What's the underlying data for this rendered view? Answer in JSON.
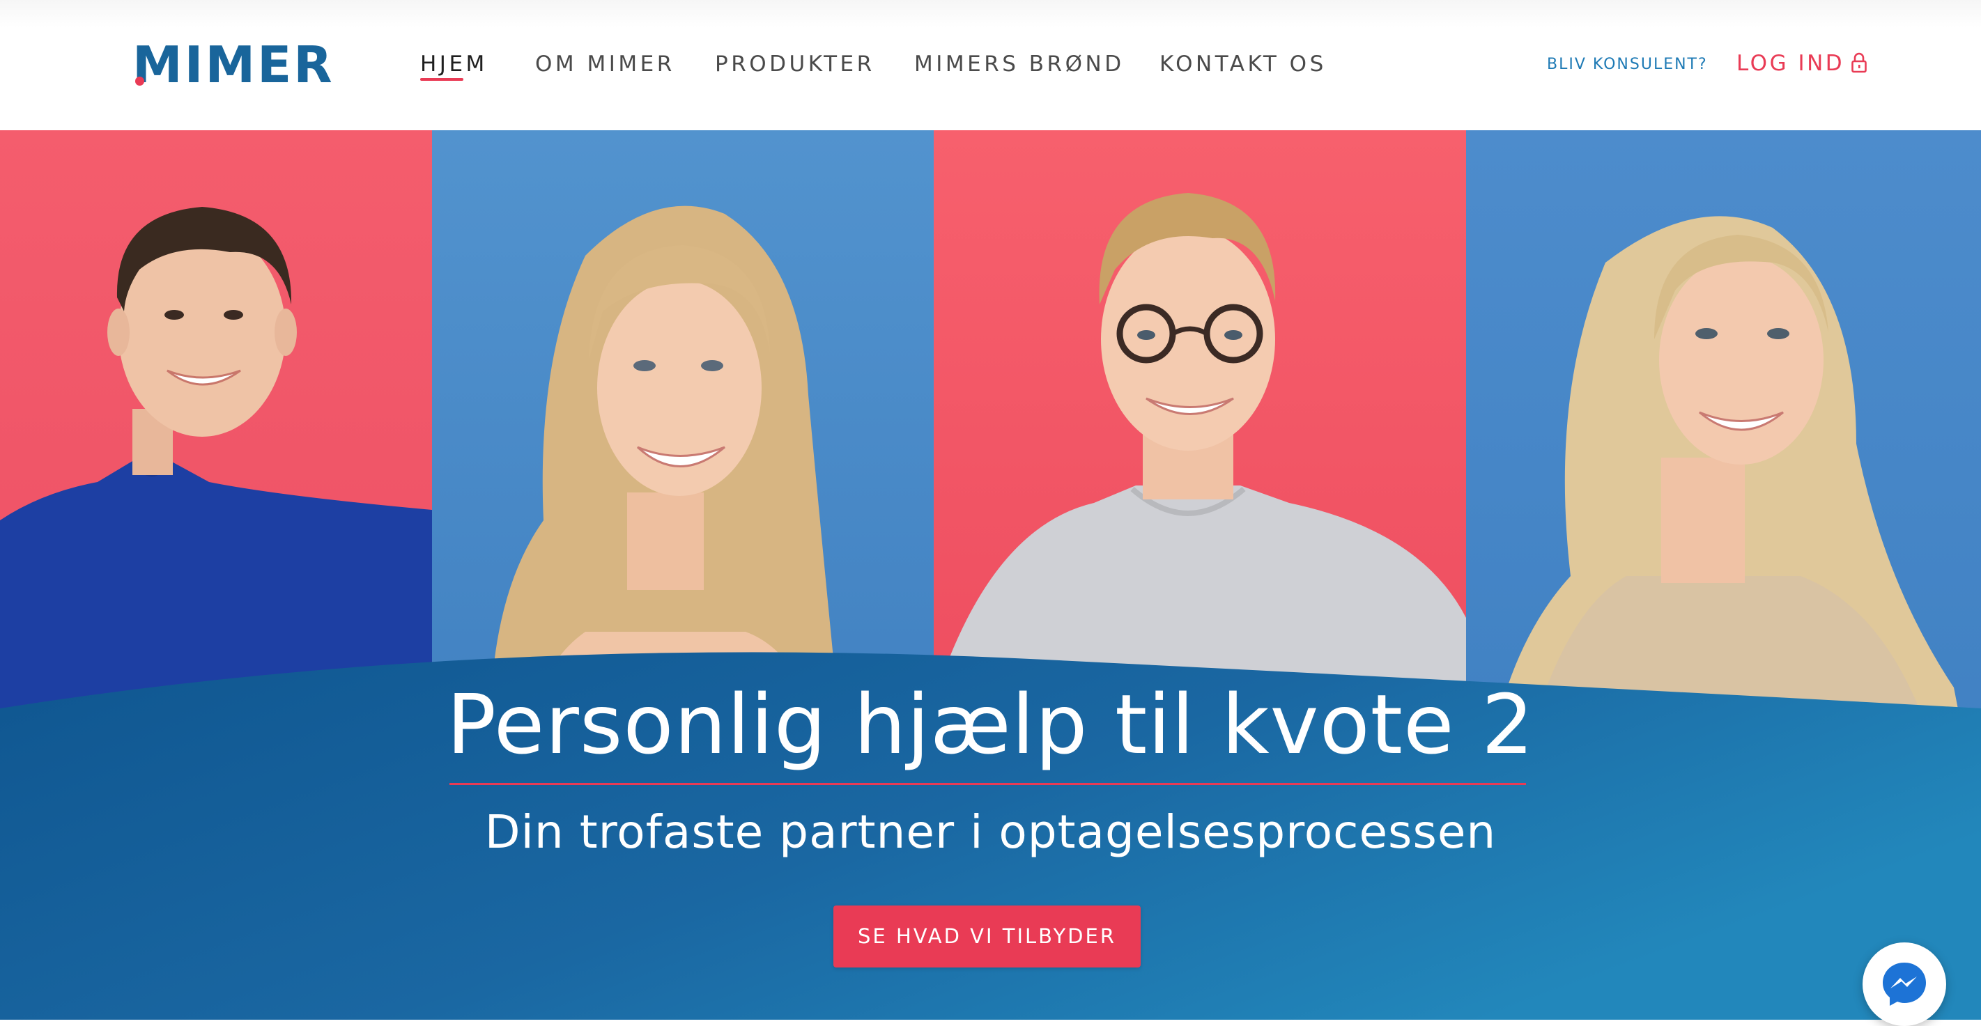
{
  "brand": {
    "name": "MIMER",
    "primary": "#19659b",
    "accent": "#e93b55"
  },
  "nav": {
    "items": [
      {
        "label": "HJEM",
        "active": true
      },
      {
        "label": "OM MIMER",
        "active": false
      },
      {
        "label": "PRODUKTER",
        "active": false
      },
      {
        "label": "MIMERS BRØND",
        "active": false
      },
      {
        "label": "KONTAKT OS",
        "active": false
      }
    ],
    "consultant_link": "BLIV KONSULENT?",
    "login_label": "LOG IND",
    "login_icon": "lock-icon"
  },
  "hero": {
    "title": "Personlig hjælp til kvote 2",
    "subtitle": "Din trofaste partner i optagelsesprocessen",
    "cta_label": "SE HVAD VI TILBYDER",
    "photo_backgrounds": [
      "#f2586a",
      "#4a8acb",
      "#f25a6a",
      "#4888c9"
    ]
  },
  "chat_widget": {
    "icon": "messenger-icon"
  }
}
